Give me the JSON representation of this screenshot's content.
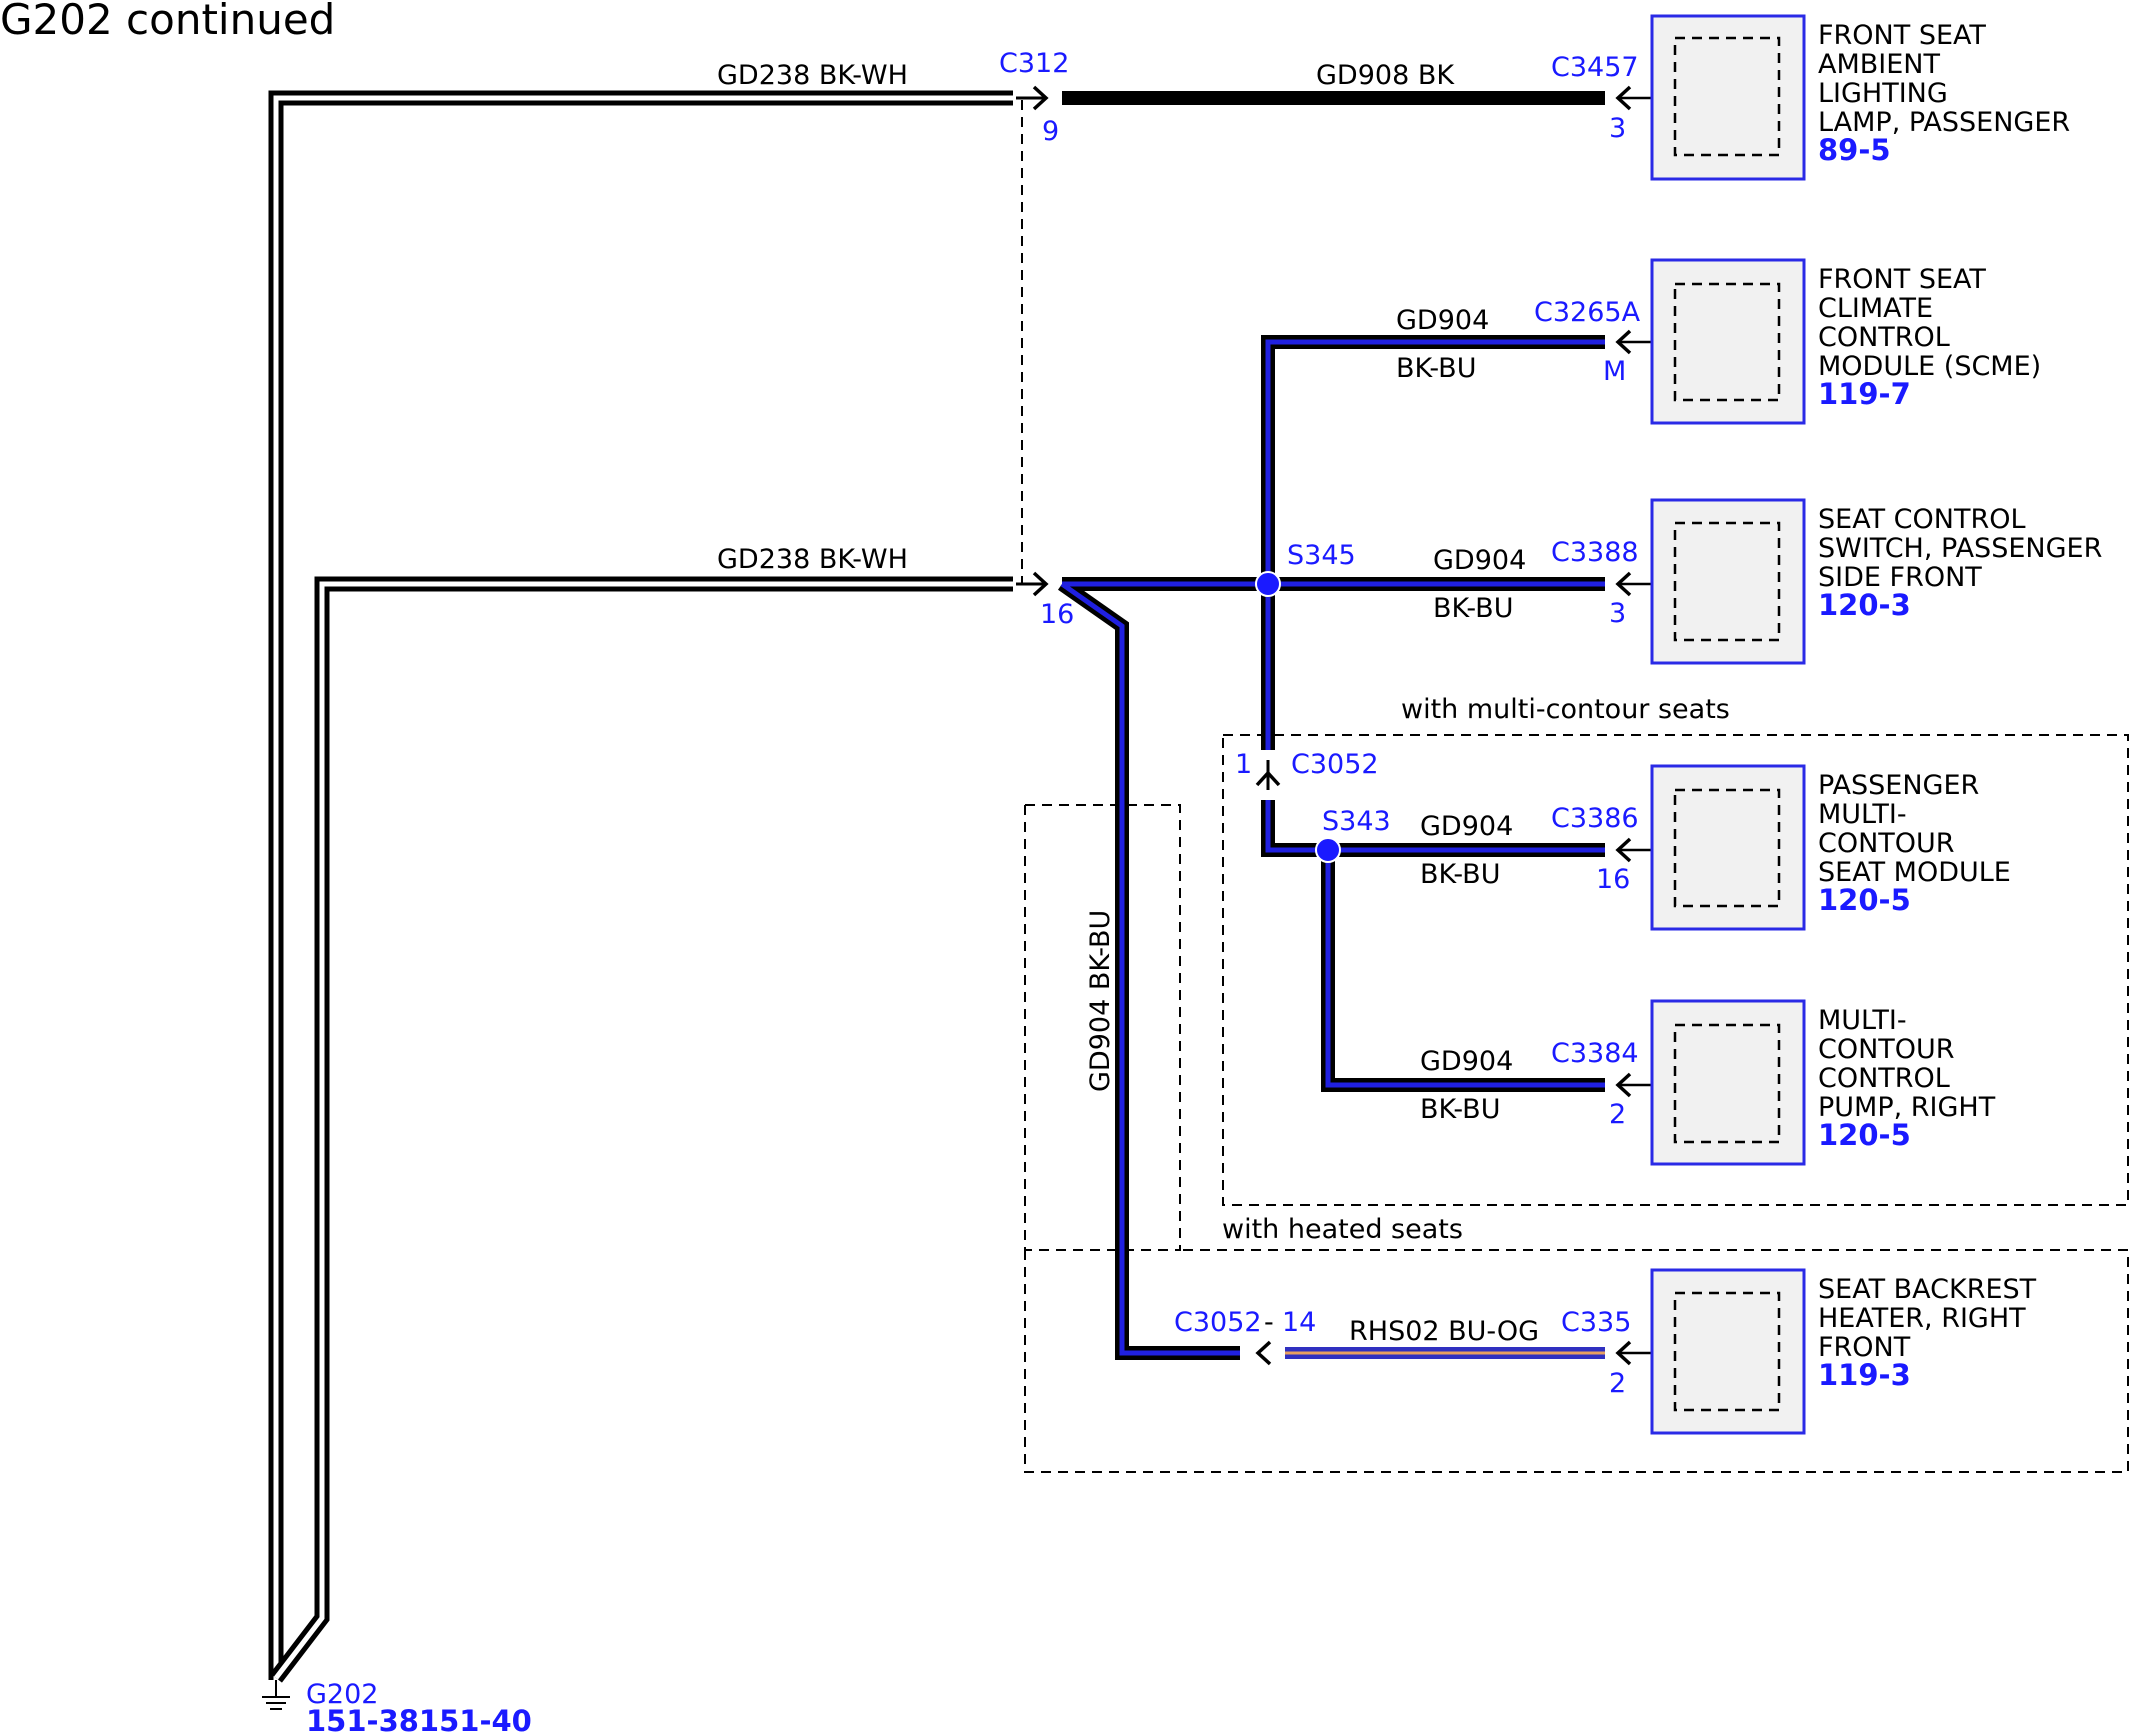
{
  "title": "G202 continued",
  "colors": {
    "connector_text": "#1a1aff",
    "splice": "#1a1aff",
    "wire_bk_bu_inner": "#2020e0",
    "component_border": "#2a2ae6",
    "component_fill": "#f1f1f1"
  },
  "ground": {
    "name": "G202",
    "ref": "151-38151-40"
  },
  "wires": {
    "gd238_top": "GD238  BK-WH",
    "gd238_mid": "GD238  BK-WH",
    "gd908": "GD908  BK",
    "gd904_scme_circuit": "GD904",
    "gd904_scme_color": "BK-BU",
    "gd904_c3388_circuit": "GD904",
    "gd904_c3388_color": "BK-BU",
    "gd904_c3386_circuit": "GD904",
    "gd904_c3386_color": "BK-BU",
    "gd904_c3384_circuit": "GD904",
    "gd904_c3384_color": "BK-BU",
    "gd904_vertical": "GD904   BK-BU",
    "rhs02": "RHS02  BU-OG"
  },
  "connectors": {
    "c312": "C312",
    "c312_pin9": "9",
    "c312_pin16": "16",
    "c3457": "C3457",
    "c3457_pin": "3",
    "c3265a": "C3265A",
    "c3265a_pin": "M",
    "c3388": "C3388",
    "c3388_pin": "3",
    "c3052": "C3052",
    "c3052_pin": "1",
    "c3386": "C3386",
    "c3386_pin": "16",
    "c3384": "C3384",
    "c3384_pin": "2",
    "c3052_14": "C3052",
    "c3052_14_sep": "-",
    "c3052_14_pin": "14",
    "c335": "C335",
    "c335_pin": "2"
  },
  "splices": {
    "s345": "S345",
    "s343": "S343"
  },
  "options": {
    "multi_contour": "with multi-contour seats",
    "heated": "with heated seats"
  },
  "components": [
    {
      "lines": [
        "FRONT SEAT",
        "AMBIENT",
        "LIGHTING",
        "LAMP, PASSENGER"
      ],
      "ref": "89-5"
    },
    {
      "lines": [
        "FRONT SEAT",
        "CLIMATE",
        "CONTROL",
        "MODULE (SCME)"
      ],
      "ref": "119-7"
    },
    {
      "lines": [
        "SEAT CONTROL",
        "SWITCH, PASSENGER",
        "SIDE FRONT"
      ],
      "ref": "120-3"
    },
    {
      "lines": [
        "PASSENGER",
        "MULTI-",
        "CONTOUR",
        "SEAT MODULE"
      ],
      "ref": "120-5"
    },
    {
      "lines": [
        "MULTI-",
        "CONTOUR",
        "CONTROL",
        "PUMP, RIGHT"
      ],
      "ref": "120-5"
    },
    {
      "lines": [
        "SEAT BACKREST",
        "HEATER, RIGHT",
        "FRONT"
      ],
      "ref": "119-3"
    }
  ]
}
